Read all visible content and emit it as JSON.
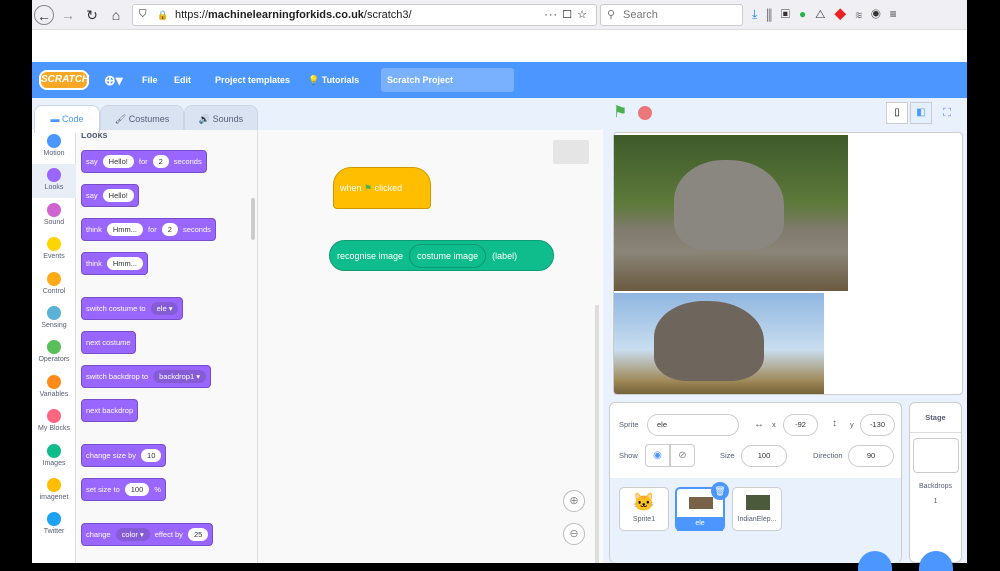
{
  "browser": {
    "url_prefix": "https://",
    "url_domain": "machinelearningforkids.co.uk",
    "url_path": "/scratch3/",
    "search_placeholder": "Search"
  },
  "menu": {
    "logo": "SCRATCH",
    "file": "File",
    "edit": "Edit",
    "templates": "Project templates",
    "tutorials": "Tutorials",
    "project_title": "Scratch Project"
  },
  "tabs": {
    "code": "Code",
    "costumes": "Costumes",
    "sounds": "Sounds"
  },
  "categories": [
    {
      "label": "Motion",
      "color": "#4c97ff"
    },
    {
      "label": "Looks",
      "color": "#9966ff"
    },
    {
      "label": "Sound",
      "color": "#cf63cf"
    },
    {
      "label": "Events",
      "color": "#ffd500"
    },
    {
      "label": "Control",
      "color": "#ffab19"
    },
    {
      "label": "Sensing",
      "color": "#5cb1d6"
    },
    {
      "label": "Operators",
      "color": "#59c059"
    },
    {
      "label": "Variables",
      "color": "#ff8c1a"
    },
    {
      "label": "My Blocks",
      "color": "#ff6680"
    },
    {
      "label": "Images",
      "color": "#0fbd8c"
    },
    {
      "label": "imagenet",
      "color": "#ffbf00"
    },
    {
      "label": "Twitter",
      "color": "#1da1f2"
    }
  ],
  "palette": {
    "heading": "Looks",
    "blocks": [
      {
        "parts": [
          {
            "t": "say"
          },
          {
            "i": "Hello!"
          },
          {
            "t": "for"
          },
          {
            "i": "2"
          },
          {
            "t": "seconds"
          }
        ]
      },
      {
        "parts": [
          {
            "t": "say"
          },
          {
            "i": "Hello!"
          }
        ]
      },
      {
        "parts": [
          {
            "t": "think"
          },
          {
            "i": "Hmm..."
          },
          {
            "t": "for"
          },
          {
            "i": "2"
          },
          {
            "t": "seconds"
          }
        ]
      },
      {
        "parts": [
          {
            "t": "think"
          },
          {
            "i": "Hmm..."
          }
        ]
      },
      {
        "parts": [
          {
            "t": "switch costume to"
          },
          {
            "d": "ele ▾"
          }
        ]
      },
      {
        "parts": [
          {
            "t": "next costume"
          }
        ]
      },
      {
        "parts": [
          {
            "t": "switch backdrop to"
          },
          {
            "d": "backdrop1 ▾"
          }
        ]
      },
      {
        "parts": [
          {
            "t": "next backdrop"
          }
        ]
      },
      {
        "parts": [
          {
            "t": "change size by"
          },
          {
            "i": "10"
          }
        ]
      },
      {
        "parts": [
          {
            "t": "set size to"
          },
          {
            "i": "100"
          },
          {
            "t": "%"
          }
        ]
      },
      {
        "parts": [
          {
            "t": "change"
          },
          {
            "d": "color ▾"
          },
          {
            "t": "effect by"
          },
          {
            "i": "25"
          }
        ]
      }
    ]
  },
  "script": {
    "hat_when": "when",
    "hat_clicked": "clicked",
    "reporter_text": "recognise image",
    "reporter_input": "costume image",
    "reporter_suffix": "(label)"
  },
  "sprite_info": {
    "sprite_label": "Sprite",
    "sprite_name": "ele",
    "x_label": "x",
    "x": "-92",
    "y_label": "y",
    "y": "-130",
    "show_label": "Show",
    "size_label": "Size",
    "size": "100",
    "direction_label": "Direction",
    "direction": "90"
  },
  "sprites": [
    {
      "name": "Sprite1"
    },
    {
      "name": "ele"
    },
    {
      "name": "IndianElep..."
    }
  ],
  "stage_pane": {
    "title": "Stage",
    "backdrops_label": "Backdrops",
    "backdrops_count": "1"
  },
  "colors": {
    "accent": "#4c97ff",
    "looks": "#9966ff",
    "events": "#ffbf00",
    "extension": "#0fbd8c"
  }
}
